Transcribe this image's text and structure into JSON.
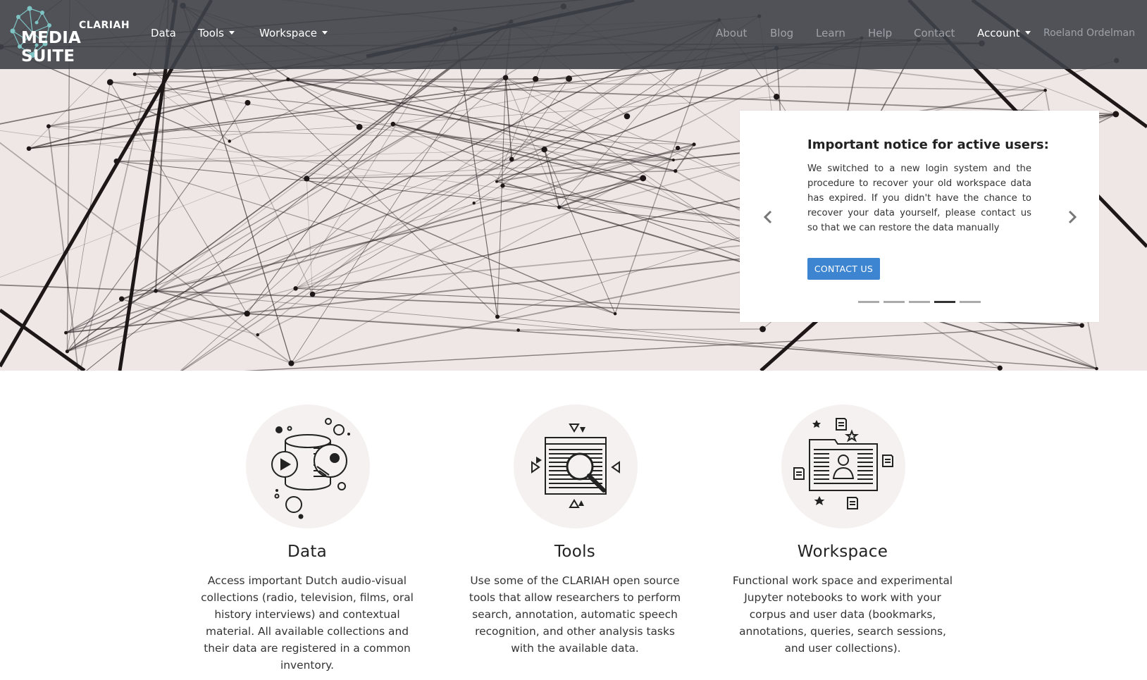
{
  "brand": {
    "top_word": "CLARIAH",
    "bottom_word": "MEDIA SUITE",
    "logo_icon": "network-nodes-icon"
  },
  "nav": {
    "left": [
      {
        "label": "Data",
        "dropdown": false
      },
      {
        "label": "Tools",
        "dropdown": true
      },
      {
        "label": "Workspace",
        "dropdown": true
      }
    ],
    "right": [
      {
        "label": "About"
      },
      {
        "label": "Blog"
      },
      {
        "label": "Learn"
      },
      {
        "label": "Help"
      },
      {
        "label": "Contact"
      }
    ],
    "account": {
      "label": "Account",
      "dropdown": true
    },
    "user": {
      "name": "Roeland Ordelman"
    }
  },
  "hero": {
    "background": "network-strings-photo",
    "notice": {
      "title": "Important notice for active users:",
      "body": "We switched to a new login system and the procedure to recover your old workspace data has expired. If you didn't have the chance to recover your data yourself, please contact us so that we can restore the data manually",
      "button_label": "CONTACT US",
      "prev_icon": "chevron-left-icon",
      "next_icon": "chevron-right-icon",
      "slides_total": 5,
      "active_slide": 4
    }
  },
  "features": [
    {
      "title": "Data",
      "icon": "database-media-icon",
      "description": "Access important Dutch audio-visual collections (radio, television, films, oral history interviews) and contextual material. All available collections and their data are registered in a common inventory."
    },
    {
      "title": "Tools",
      "icon": "magnifier-document-icon",
      "description": "Use some of the CLARIAH open source tools that allow researchers to perform search, annotation, automatic speech recognition, and other analysis tasks with the available data."
    },
    {
      "title": "Workspace",
      "icon": "user-folder-icon",
      "description": "Functional work space and experimental Jupyter notebooks to work with your corpus and user data (bookmarks, annotations, queries, search sessions, and user collections)."
    }
  ],
  "colors": {
    "navbar": "#3e4148",
    "primary_button": "#3d85d0",
    "logo_accent": "#7fc4c4",
    "hero_bg": "#efe7e5"
  }
}
